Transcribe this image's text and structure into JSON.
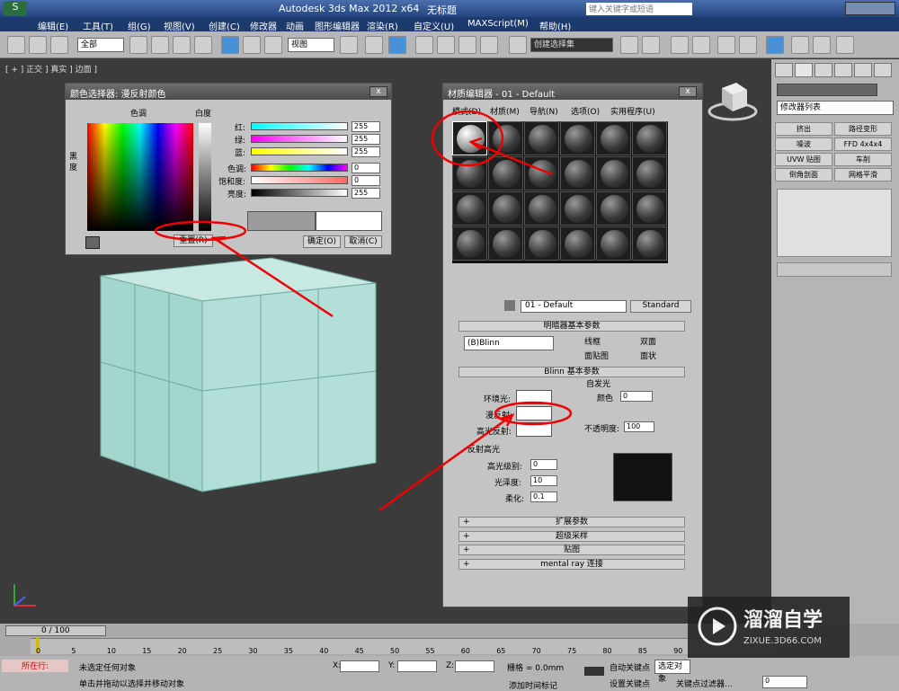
{
  "app": {
    "title": "Autodesk 3ds Max  2012 x64",
    "doc": "无标题",
    "search_placeholder": "键入关键字或短语"
  },
  "menu": [
    "编辑(E)",
    "工具(T)",
    "组(G)",
    "视图(V)",
    "创建(C)",
    "修改器",
    "动画",
    "图形编辑器",
    "渲染(R)",
    "自定义(U)",
    "MAXScript(M)",
    "帮助(H)"
  ],
  "toolbar": {
    "filter": "全部",
    "refcoord": "视图",
    "selset": "创建选择集"
  },
  "viewport": {
    "label": "[ + ] 正交 ] 真实 ] 边面 ]"
  },
  "color_picker": {
    "title": "颜色选择器: 漫反射颜色",
    "hue_label": "色调",
    "white_label": "白度",
    "black_label": "黑度",
    "channels": [
      {
        "label": "红:",
        "value": "255"
      },
      {
        "label": "绿:",
        "value": "255"
      },
      {
        "label": "蓝:",
        "value": "255"
      },
      {
        "label": "色调:",
        "value": "0"
      },
      {
        "label": "饱和度:",
        "value": "0"
      },
      {
        "label": "亮度:",
        "value": "255"
      }
    ],
    "reset": "重置(R)",
    "ok": "确定(O)",
    "cancel": "取消(C)"
  },
  "material_editor": {
    "title": "材质编辑器 - 01 - Default",
    "menus": [
      "模式(D)",
      "材质(M)",
      "导航(N)",
      "选项(O)",
      "实用程序(U)"
    ],
    "material_name": "01 - Default",
    "material_type": "Standard",
    "shader_rollout": "明暗器基本参数",
    "shader": "(B)Blinn",
    "checks": [
      "线框",
      "双面",
      "面贴图",
      "面状"
    ],
    "blinn_rollout": "Blinn 基本参数",
    "self_illum": "自发光",
    "color_label": "颜色",
    "self_illum_value": "0",
    "ambient": "环境光:",
    "diffuse": "漫反射:",
    "specular": "高光反射:",
    "opacity_label": "不透明度:",
    "opacity": "100",
    "spec_group": "反射高光",
    "spec_level_label": "高光级别:",
    "spec_level": "0",
    "gloss_label": "光泽度:",
    "gloss": "10",
    "soften_label": "柔化:",
    "soften": "0.1",
    "rollouts": [
      "扩展参数",
      "超级采样",
      "贴图",
      "mental ray 连接"
    ]
  },
  "command_panel": {
    "modifier_list": "修改器列表",
    "buttons": [
      "挤出",
      "路径变形",
      "噪波",
      "FFD 4x4x4",
      "UVW 贴图",
      "车削",
      "倒角剖面",
      "网格平滑"
    ]
  },
  "timeline": {
    "frame": "0 / 100",
    "ticks": [
      "0",
      "5",
      "10",
      "15",
      "20",
      "25",
      "30",
      "35",
      "40",
      "45",
      "50",
      "55",
      "60",
      "65",
      "70",
      "75",
      "80",
      "85",
      "90"
    ]
  },
  "status": {
    "selection": "未选定任何对象",
    "prompt": "单击并拖动以选择并移动对象",
    "running": "所在行:",
    "grid": "栅格 = 0.0mm",
    "add_time_tag": "添加时间标记",
    "auto_key": "自动关键点",
    "auto_key_value": "选定对象",
    "set_key": "设置关键点",
    "key_filter": "关键点过滤器...",
    "frame_value": "0",
    "x": "X:",
    "y": "Y:",
    "z": "Z:"
  },
  "watermark": {
    "brand": "溜溜自学",
    "url": "ZIXUE.3D66.COM"
  }
}
